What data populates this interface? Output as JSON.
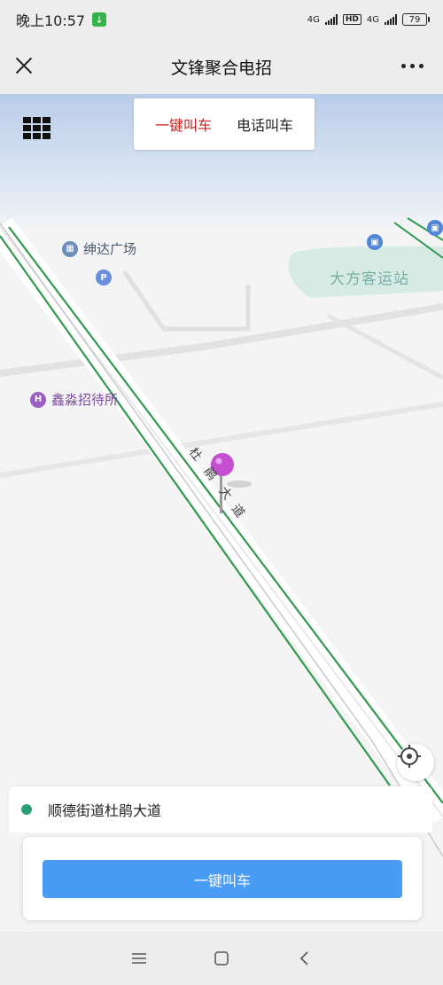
{
  "status_bar": {
    "time": "晚上10:57",
    "network_1": "4G",
    "hd": "HD",
    "network_2": "4G",
    "battery": "79"
  },
  "header": {
    "title": "文锋聚合电招"
  },
  "mode_tabs": [
    {
      "label": "一键叫车",
      "active": true
    },
    {
      "label": "电话叫车",
      "active": false
    }
  ],
  "map": {
    "pois": [
      {
        "name": "绅达广场",
        "icon": "building-icon"
      },
      {
        "name": "鑫淼招待所",
        "icon": "hotel-icon"
      },
      {
        "name": "大方客运站",
        "icon": "bus-station-icon"
      }
    ],
    "road_name_chars": [
      "杜",
      "鹃",
      "大",
      "道"
    ],
    "parking_icon": "P",
    "pin_color": "#c44fd0",
    "road_color": "#2e9a4f"
  },
  "address": {
    "text": "顺德街道杜鹃大道",
    "dot_color": "#2a9e7a"
  },
  "call_button": {
    "label": "一键叫车",
    "color": "#4a9bf5"
  },
  "nav": {
    "menu": "menu-icon",
    "home": "home-icon",
    "back": "back-icon"
  }
}
